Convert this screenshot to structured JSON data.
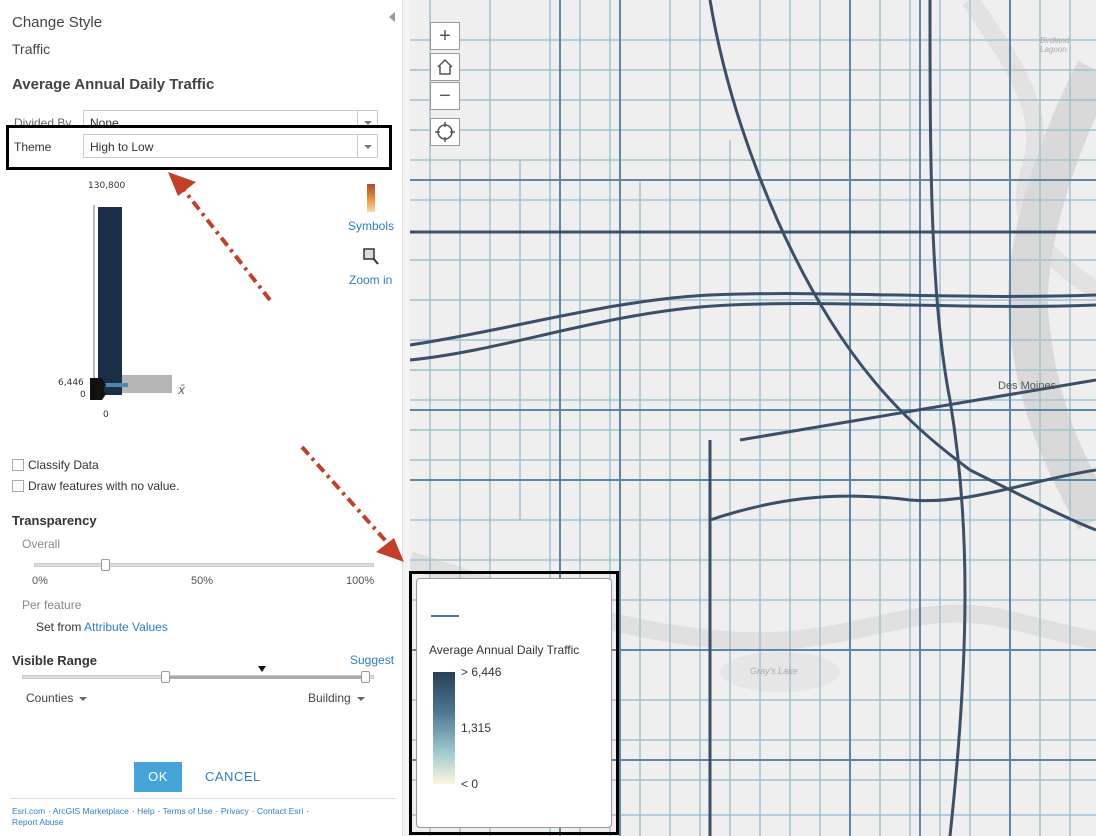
{
  "panel": {
    "title": "Change Style",
    "layer": "Traffic",
    "field": "Average Annual Daily Traffic",
    "divided_by_label": "Divided By",
    "divided_by_value": "None",
    "theme_label": "Theme",
    "theme_value": "High to Low",
    "histogram": {
      "max_label": "130,800",
      "value_label": "6,446",
      "min_label": "0",
      "bottom_label": "0",
      "mean_symbol": "x̄"
    },
    "symbols_label": "Symbols",
    "zoom_label": "Zoom in",
    "classify_label": "Classify Data",
    "draw_no_value_label": "Draw features with no value.",
    "transparency_title": "Transparency",
    "overall_label": "Overall",
    "ticks": [
      "0%",
      "50%",
      "100%"
    ],
    "per_feature_label": "Per feature",
    "set_from_label": "Set from",
    "attribute_values_link": "Attribute Values",
    "visible_range_title": "Visible Range",
    "suggest_link": "Suggest",
    "range_min": "Counties",
    "range_max": "Building",
    "ok_label": "OK",
    "cancel_label": "CANCEL",
    "footer_links": [
      "Esri.com",
      "ArcGIS Marketplace",
      "Help",
      "Terms of Use",
      "Privacy",
      "Contact Esri",
      "Report Abuse"
    ]
  },
  "map": {
    "zoom_in": "+",
    "zoom_out": "−",
    "city_label": "Des Moines",
    "lake_label": "Gray's Lake",
    "lagoon_label": "Birdland Lagoon"
  },
  "legend": {
    "title": "Average Annual Daily Traffic",
    "high": "> 6,446",
    "mid": "1,315",
    "low": "< 0"
  },
  "colors": {
    "accent": "#2f7fc1",
    "ok_button": "#46a3d8",
    "road_dark": "#3b5068",
    "road_light": "#8fb8c8",
    "annotation_arrow": "#c0402a"
  }
}
